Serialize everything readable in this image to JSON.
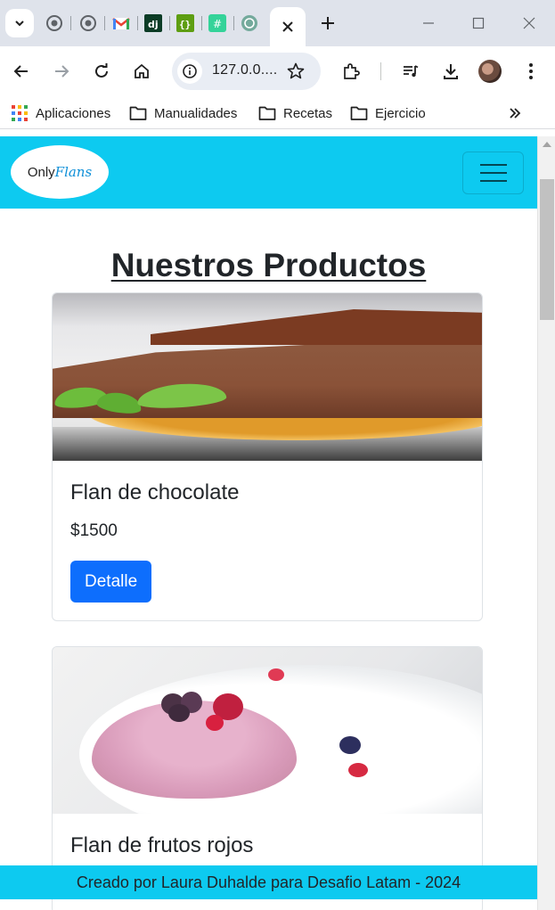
{
  "browser": {
    "url": "127.0.0....",
    "bookmarks": [
      {
        "label": "Aplicaciones",
        "icon": "apps-grid-icon"
      },
      {
        "label": "Manualidades",
        "icon": "folder-icon"
      },
      {
        "label": "Recetas",
        "icon": "folder-icon"
      },
      {
        "label": "Ejercicio",
        "icon": "folder-icon"
      }
    ],
    "tab_favicons": [
      "github-icon",
      "github-icon",
      "gmail-icon",
      "django-icon",
      "code-icon",
      "hashtag-icon",
      "chatgpt-icon"
    ]
  },
  "navbar": {
    "logo_only": "Only",
    "logo_flans": "Flans"
  },
  "main": {
    "title": "Nuestros Productos",
    "products": [
      {
        "name": "Flan de chocolate",
        "price": "$1500",
        "button": "Detalle"
      },
      {
        "name": "Flan de frutos rojos"
      }
    ]
  },
  "footer": {
    "text": "Creado por Laura Duhalde para Desafio Latam - 2024"
  },
  "colors": {
    "navbar_bg": "#0dcaf0",
    "button_bg": "#0d6efd",
    "text": "#212529"
  }
}
